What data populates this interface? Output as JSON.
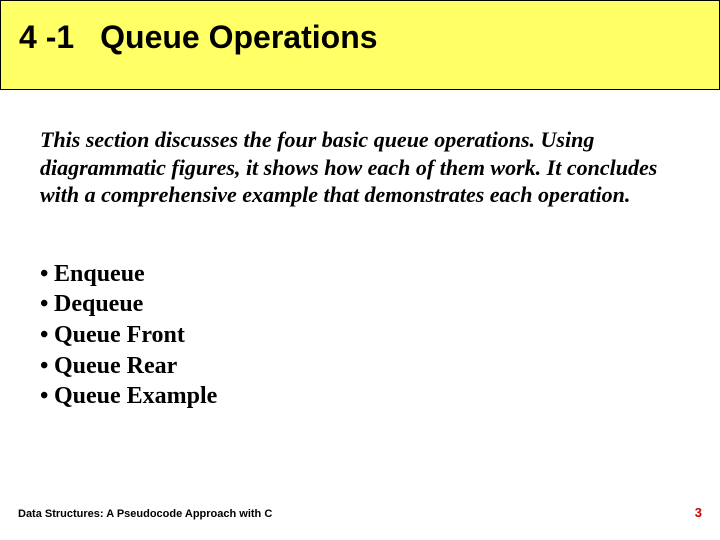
{
  "title": {
    "number": "4 -1",
    "text": "Queue Operations"
  },
  "intro": "This section discusses the four basic queue operations. Using diagrammatic figures, it shows how each of them work. It concludes with a comprehensive example that demonstrates each operation.",
  "bullets": [
    "Enqueue",
    "Dequeue",
    "Queue Front",
    "Queue Rear",
    "Queue Example"
  ],
  "footer": {
    "book": "Data Structures: A Pseudocode Approach with C",
    "page": "3"
  }
}
